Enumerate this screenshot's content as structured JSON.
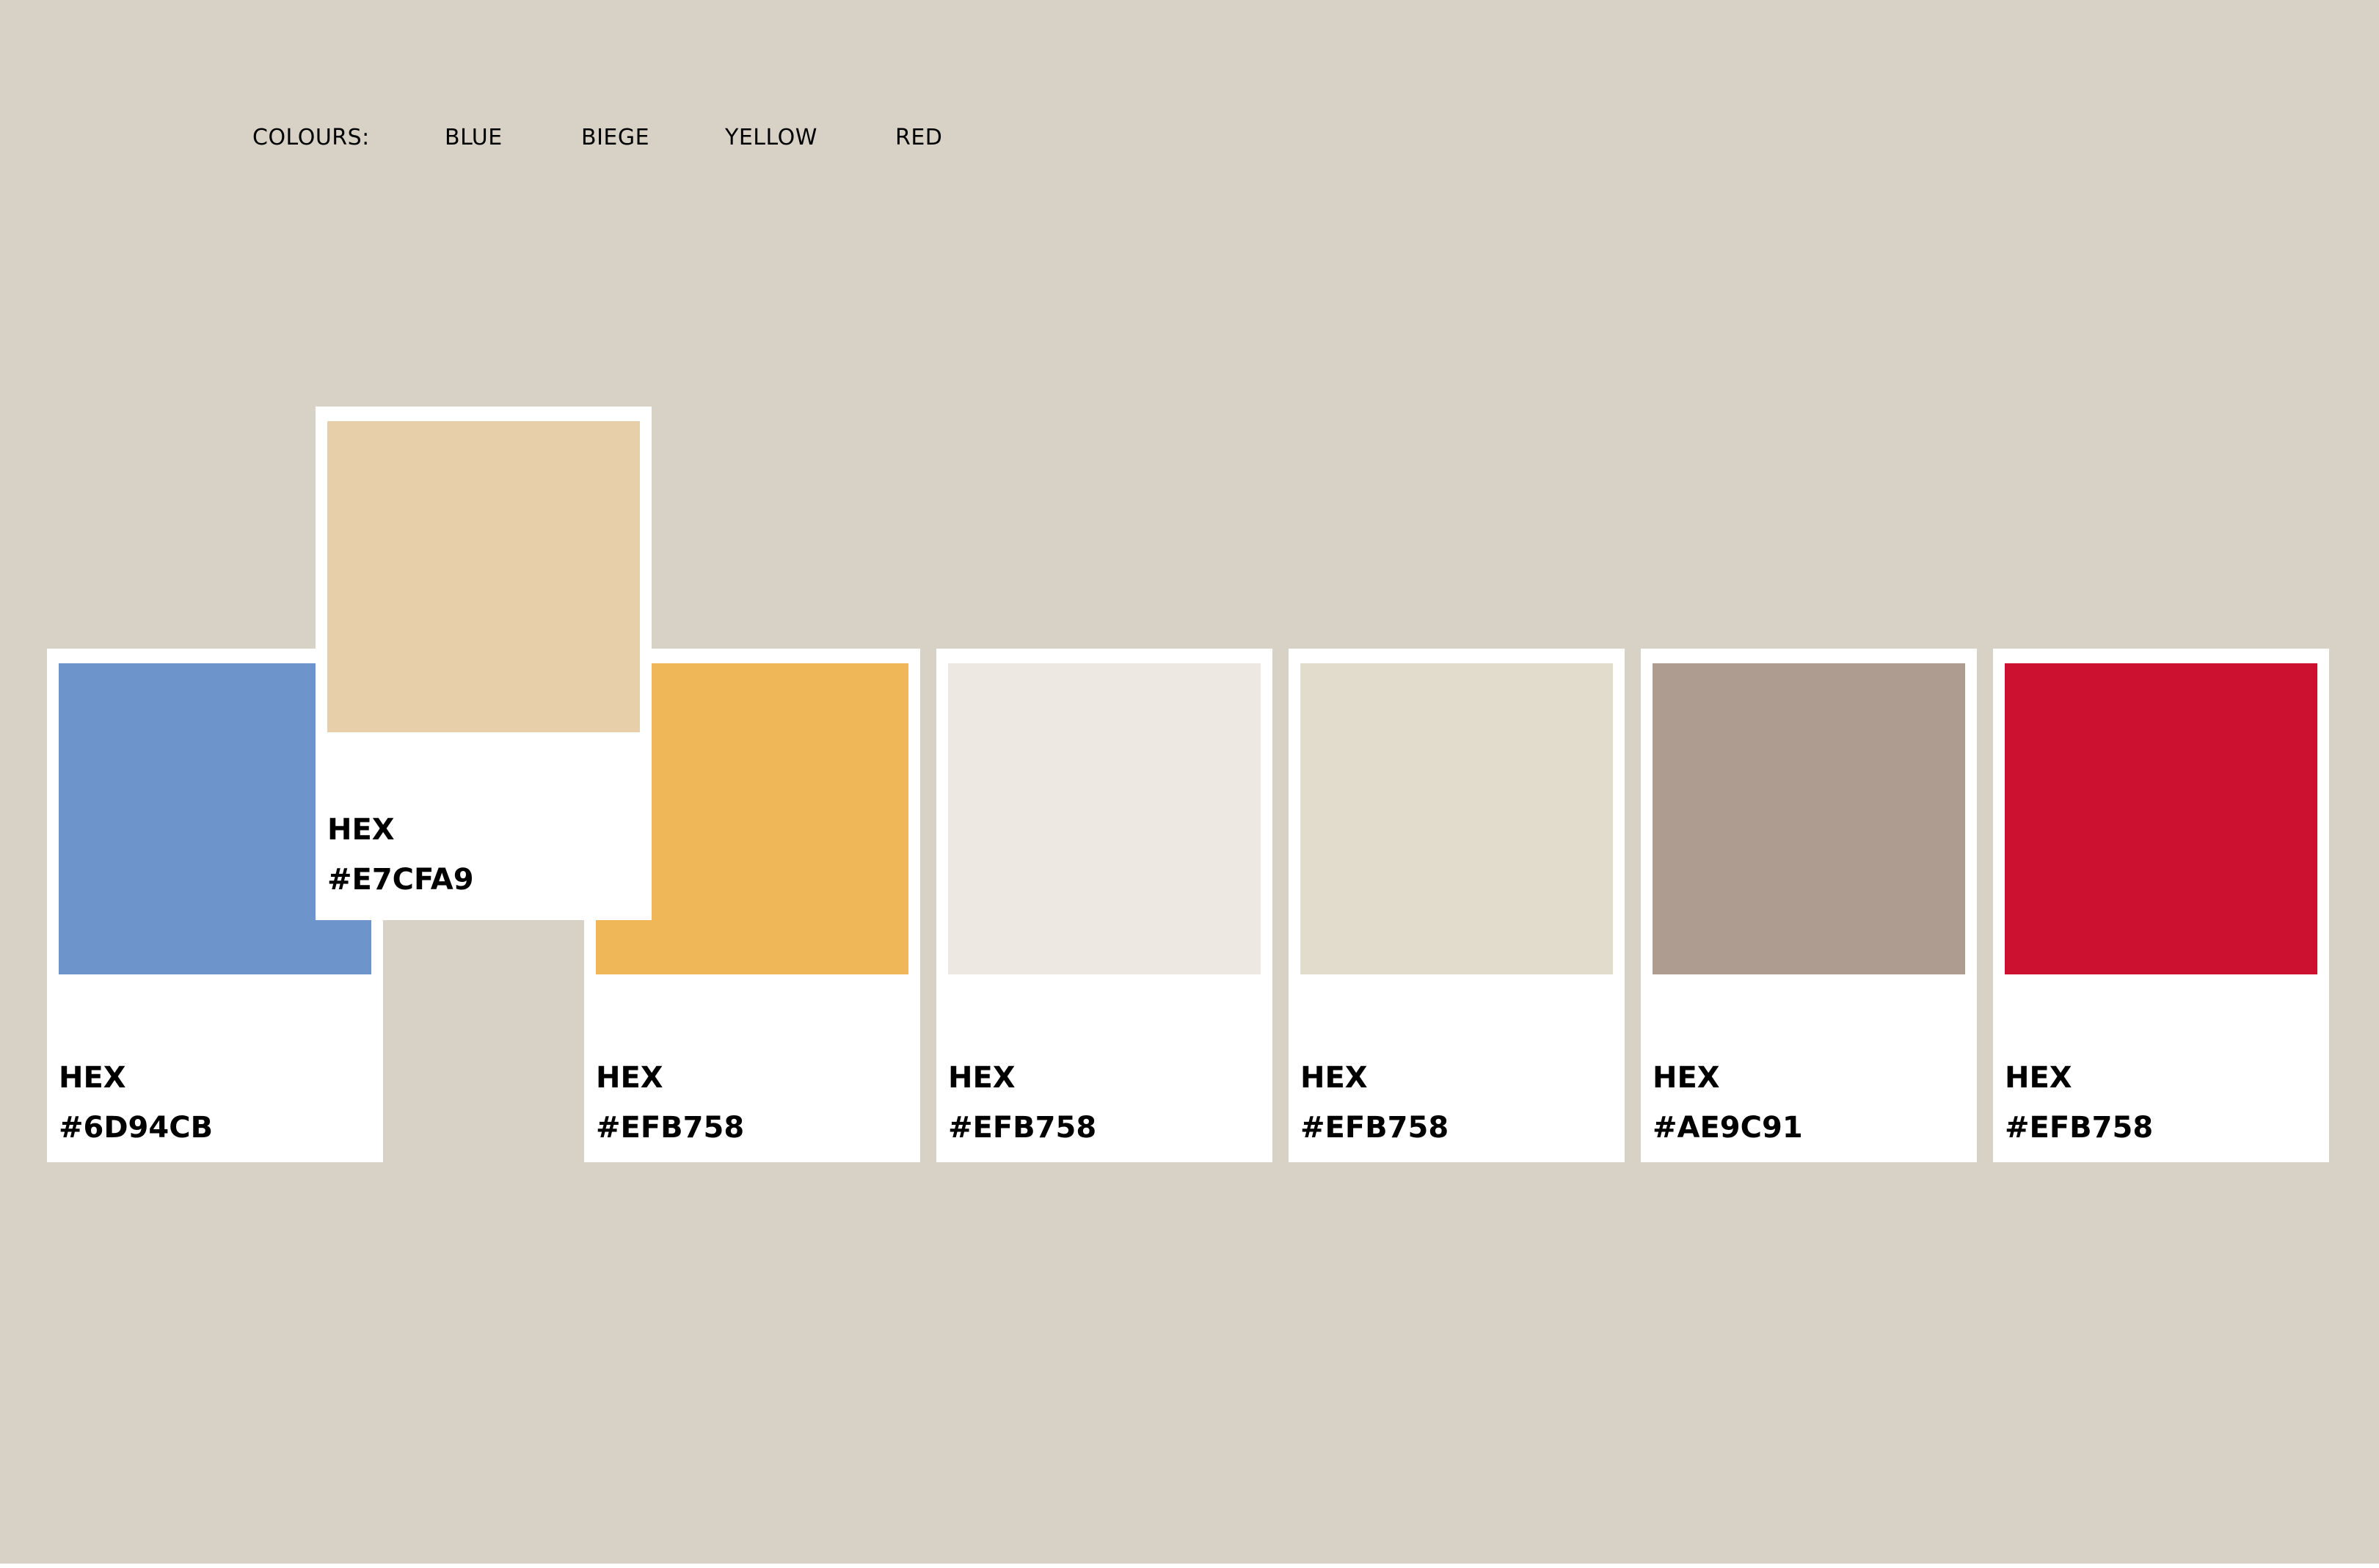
{
  "nav": {
    "label": "COLOURS:",
    "items": [
      "BLUE",
      "BIEGE",
      "YELLOW",
      "RED"
    ]
  },
  "cards": [
    {
      "label": "HEX",
      "hex": "#6D94CB",
      "color": "#6D94CB"
    },
    {
      "label": "HEX",
      "hex": "#E7CFA9",
      "color": "#E7CFA9",
      "raised": true
    },
    {
      "label": "HEX",
      "hex": "#EFB758",
      "color": "#EFB758"
    },
    {
      "label": "HEX",
      "hex": "#EFB758",
      "color": "#EDE8E1"
    },
    {
      "label": "HEX",
      "hex": "#EFB758",
      "color": "#E2DCCC"
    },
    {
      "label": "HEX",
      "hex": "#AE9C91",
      "color": "#AE9C91"
    },
    {
      "label": "HEX",
      "hex": "#EFB758",
      "color": "#CB1030"
    }
  ],
  "colors": {
    "background": "#D8D1C5",
    "card": "#FFFFFF"
  }
}
